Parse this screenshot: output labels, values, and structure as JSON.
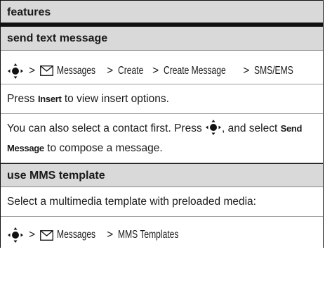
{
  "header": {
    "label": "features"
  },
  "sections": [
    {
      "title": "send text message",
      "path": {
        "sep": ">",
        "items": [
          "Messages",
          "Create",
          "Create Message",
          "SMS/EMS"
        ]
      },
      "p1": {
        "before": "Press ",
        "key": "Insert",
        "after": " to view insert options."
      },
      "p2": {
        "before": "You can also select a contact first. Press ",
        "mid": ", and select ",
        "key": "Send Message",
        "after": " to compose a message."
      }
    },
    {
      "title": "use MMS template",
      "desc": "Select a multimedia template with preloaded media:",
      "path": {
        "sep": ">",
        "items": [
          "Messages",
          "MMS Templates"
        ]
      }
    }
  ],
  "icons": [
    "nav-key-icon",
    "envelope-icon"
  ]
}
